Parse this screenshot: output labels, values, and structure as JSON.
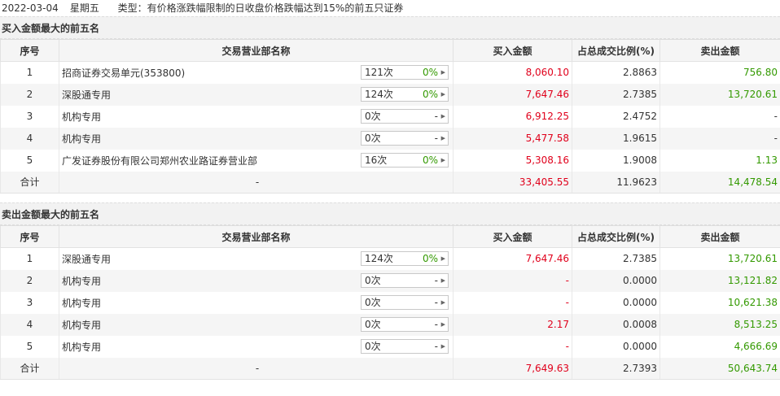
{
  "header": {
    "date": "2022-03-04",
    "weekday": "星期五",
    "type_text": "类型：有价格涨跌幅限制的日收盘价格跌幅达到15%的前五只证券"
  },
  "columns": {
    "idx": "序号",
    "name": "交易营业部名称",
    "buy": "买入金额",
    "ratio": "占总成交比例(%)",
    "sell": "卖出金额"
  },
  "buy_section": {
    "title": "买入金额最大的前五名",
    "rows": [
      {
        "idx": "1",
        "name": "招商证券交易单元(353800)",
        "count": "121次",
        "pct": "0%",
        "buy": "8,060.10",
        "ratio": "2.8863",
        "sell": "756.80"
      },
      {
        "idx": "2",
        "name": "深股通专用",
        "count": "124次",
        "pct": "0%",
        "buy": "7,647.46",
        "ratio": "2.7385",
        "sell": "13,720.61"
      },
      {
        "idx": "3",
        "name": "机构专用",
        "count": "0次",
        "pct": "-",
        "buy": "6,912.25",
        "ratio": "2.4752",
        "sell": "-"
      },
      {
        "idx": "4",
        "name": "机构专用",
        "count": "0次",
        "pct": "-",
        "buy": "5,477.58",
        "ratio": "1.9615",
        "sell": "-"
      },
      {
        "idx": "5",
        "name": "广发证券股份有限公司郑州农业路证券营业部",
        "count": "16次",
        "pct": "0%",
        "buy": "5,308.16",
        "ratio": "1.9008",
        "sell": "1.13"
      }
    ],
    "total": {
      "label": "合计",
      "name": "-",
      "buy": "33,405.55",
      "ratio": "11.9623",
      "sell": "14,478.54"
    }
  },
  "sell_section": {
    "title": "卖出金额最大的前五名",
    "rows": [
      {
        "idx": "1",
        "name": "深股通专用",
        "count": "124次",
        "pct": "0%",
        "buy": "7,647.46",
        "ratio": "2.7385",
        "sell": "13,720.61"
      },
      {
        "idx": "2",
        "name": "机构专用",
        "count": "0次",
        "pct": "-",
        "buy": "-",
        "ratio": "0.0000",
        "sell": "13,121.82"
      },
      {
        "idx": "3",
        "name": "机构专用",
        "count": "0次",
        "pct": "-",
        "buy": "-",
        "ratio": "0.0000",
        "sell": "10,621.38"
      },
      {
        "idx": "4",
        "name": "机构专用",
        "count": "0次",
        "pct": "-",
        "buy": "2.17",
        "ratio": "0.0008",
        "sell": "8,513.25"
      },
      {
        "idx": "5",
        "name": "机构专用",
        "count": "0次",
        "pct": "-",
        "buy": "-",
        "ratio": "0.0000",
        "sell": "4,666.69"
      }
    ],
    "total": {
      "label": "合计",
      "name": "-",
      "buy": "7,649.63",
      "ratio": "2.7393",
      "sell": "50,643.74"
    }
  },
  "colors": {
    "buy_red": "#e0001b",
    "sell_green": "#339900",
    "header_bg": "#f5f5f5"
  },
  "icons": {
    "count_arrow": "caret-right-icon"
  }
}
